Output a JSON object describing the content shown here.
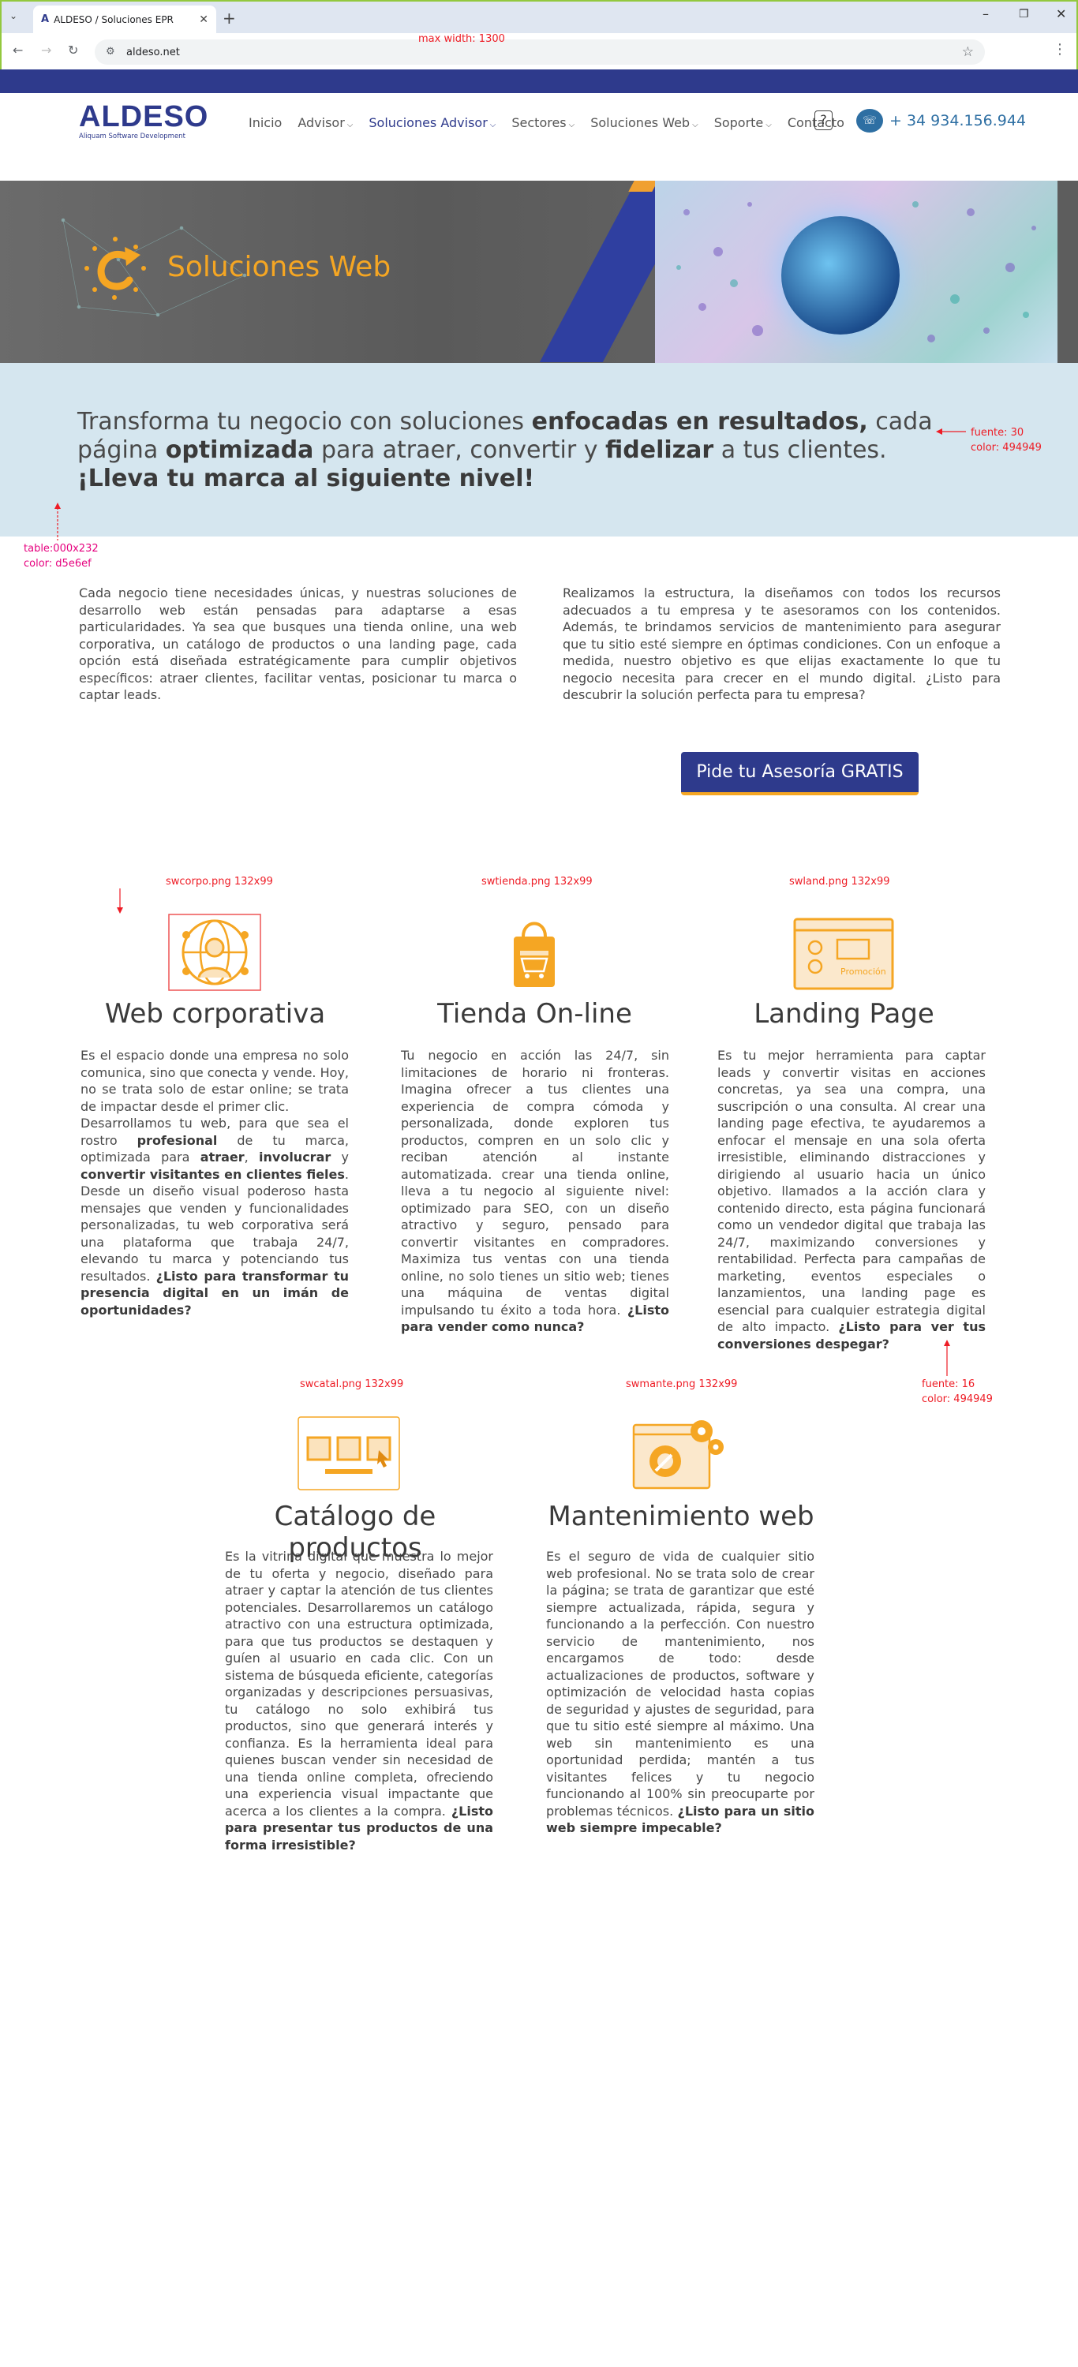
{
  "browser": {
    "tab_title": "ALDESO / Soluciones EPR",
    "tab_favicon": "A",
    "url": "aldeso.net"
  },
  "annotations": {
    "max_width": "max width: 1300",
    "font_30": "fuente: 30",
    "color_30": "color: 494949",
    "table": "table:000x232",
    "table_color": "color: d5e6ef",
    "swcorpo": "swcorpo.png 132x99",
    "swtienda": "swtienda.png 132x99",
    "swland": "swland.png 132x99",
    "font_16": "fuente: 16",
    "color_16": "color: 494949",
    "swcatal": "swcatal.png 132x99",
    "swmante": "swmante.png 132x99"
  },
  "site": {
    "logo": "ALDESO",
    "logo_sub": "Aliquam Software Development",
    "menu": [
      {
        "label": "Inicio",
        "caret": ""
      },
      {
        "label": "Advisor",
        "caret": "⌵"
      },
      {
        "label": "Soluciones Advisor",
        "caret": "⌵"
      },
      {
        "label": "Sectores",
        "caret": "⌵"
      },
      {
        "label": "Soluciones Web",
        "caret": "⌵"
      },
      {
        "label": "Soporte",
        "caret": "⌵"
      },
      {
        "label": "Contacto",
        "caret": ""
      }
    ],
    "help": "?",
    "phone": "+ 34 934.156.944"
  },
  "banner": {
    "title": "Soluciones Web"
  },
  "intro": {
    "t1": "Transforma tu negocio   con soluciones ",
    "b1": "enfocadas en resultados,",
    "t2": " cada página ",
    "b2": "optimizada",
    "t3": " para atraer, convertir y ",
    "b3": "fidelizar",
    "t4": " a tus clientes. ",
    "b4": "¡Lleva tu marca al siguiente nivel!"
  },
  "paragraphs": {
    "left": "Cada negocio tiene necesidades únicas, y nuestras soluciones de desarrollo web están pensadas para adaptarse a esas particularidades. Ya sea que busques una tienda online, una web corporativa, un catálogo de productos o una landing page, cada opción está diseñada estratégicamente para cumplir objetivos específicos: atraer clientes, facilitar ventas, posicionar tu marca o captar leads.",
    "right": "Realizamos la estructura, la diseñamos con todos los recursos adecuados a tu empresa y te asesoramos con los contenidos. Además, te brindamos servicios de mantenimiento para asegurar que tu sitio esté siempre en óptimas condiciones. Con un enfoque a medida, nuestro objetivo es que elijas exactamente lo que tu negocio necesita para crecer en el mundo digital. ¿Listo para descubrir la solución perfecta para tu empresa?"
  },
  "cta": "Pide tu Asesoría GRATIS",
  "services": {
    "corporativa": {
      "title": "Web corporativa",
      "p1": "Es el espacio donde una empresa no solo comunica, sino que conecta y vende. Hoy, no se trata solo de estar online; se trata de impactar desde el primer clic.",
      "p2a": "Desarrollamos tu web, para que sea el rostro ",
      "p2b": "profesional",
      "p2c": " de tu marca, optimizada para ",
      "p2d": "atraer",
      "p2e": ", ",
      "p2f": "involucrar",
      "p2g": " y ",
      "p2h": "convertir visitantes en clientes fieles",
      "p2i": ". Desde un diseño visual poderoso hasta mensajes que venden y funcionalidades personalizadas, tu web corporativa será una plataforma que trabaja 24/7, elevando tu marca y potenciando tus resultados. ",
      "p2j": "¿Listo para transformar tu presencia digital en un imán de oportunidades?"
    },
    "tienda": {
      "title": "Tienda On-line",
      "p": "Tu negocio en acción las 24/7, sin limitaciones de horario ni fronteras. Imagina ofrecer a tus clientes una experiencia de compra cómoda y personalizada, donde exploren tus productos, compren en un solo clic y reciban atención al instante automatizada. crear una tienda online, lleva a tu negocio al siguiente nivel: optimizado para SEO, con un diseño atractivo y seguro, pensado para convertir visitantes en compradores. Maximiza tus ventas con una tienda online, no solo tienes un sitio web; tienes una máquina de ventas digital impulsando tu éxito a toda hora. ",
      "b": "¿Listo para vender como nunca?"
    },
    "landing": {
      "title": "Landing Page",
      "icon_text": "Promoción",
      "p": "Es tu mejor herramienta para captar leads y convertir visitas en acciones concretas, ya sea una compra, una suscripción o una consulta. Al crear una landing page efectiva, te ayudaremos a enfocar el mensaje en una sola oferta irresistible, eliminando distracciones y dirigiendo al usuario hacia un único objetivo. llamados a la acción clara y contenido directo, esta página funcionará como un vendedor digital que trabaja las 24/7, maximizando conversiones y rentabilidad. Perfecta para campañas de marketing, eventos especiales o lanzamientos, una landing page es esencial para cualquier estrategia digital de alto impacto. ",
      "b": "¿Listo para ver tus conversiones despegar?"
    },
    "catalogo": {
      "title": "Catálogo de productos",
      "p": "Es la vitrina digital que muestra lo mejor de tu oferta y negocio, diseñado para atraer y captar la atención de tus clientes potenciales. Desarrollaremos un catálogo atractivo con una estructura optimizada, para que tus productos se destaquen y guíen al usuario en cada clic. Con un sistema de búsqueda eficiente, categorías organizadas y descripciones persuasivas, tu catálogo no solo exhibirá tus productos, sino que generará interés y confianza. Es la herramienta ideal para quienes buscan vender sin necesidad de una tienda online completa, ofreciendo una experiencia visual impactante que acerca a los clientes a la compra. ",
      "b": "¿Listo para presentar tus productos de una forma irresistible?"
    },
    "mantenimiento": {
      "title": "Mantenimiento web",
      "p": "Es el seguro de vida de cualquier sitio web profesional. No se trata solo de crear la página; se trata de garantizar que esté siempre actualizada, rápida, segura y funcionando a la perfección. Con nuestro servicio de mantenimiento, nos encargamos de todo: desde actualizaciones de productos, software y optimización de velocidad hasta copias de seguridad y ajustes de seguridad, para que tu sitio esté siempre al máximo. Una web sin mantenimiento es una oportunidad perdida; mantén a tus visitantes felices y tu negocio funcionando al 100% sin preocuparte por problemas técnicos. ",
      "b": "¿Listo para un sitio web siempre impecable?"
    }
  },
  "colors": {
    "brand": "#2e3a8c",
    "accent": "#f5a623",
    "intro_bg": "#d5e6ef",
    "text": "#494949",
    "note": "#ee1c25"
  }
}
